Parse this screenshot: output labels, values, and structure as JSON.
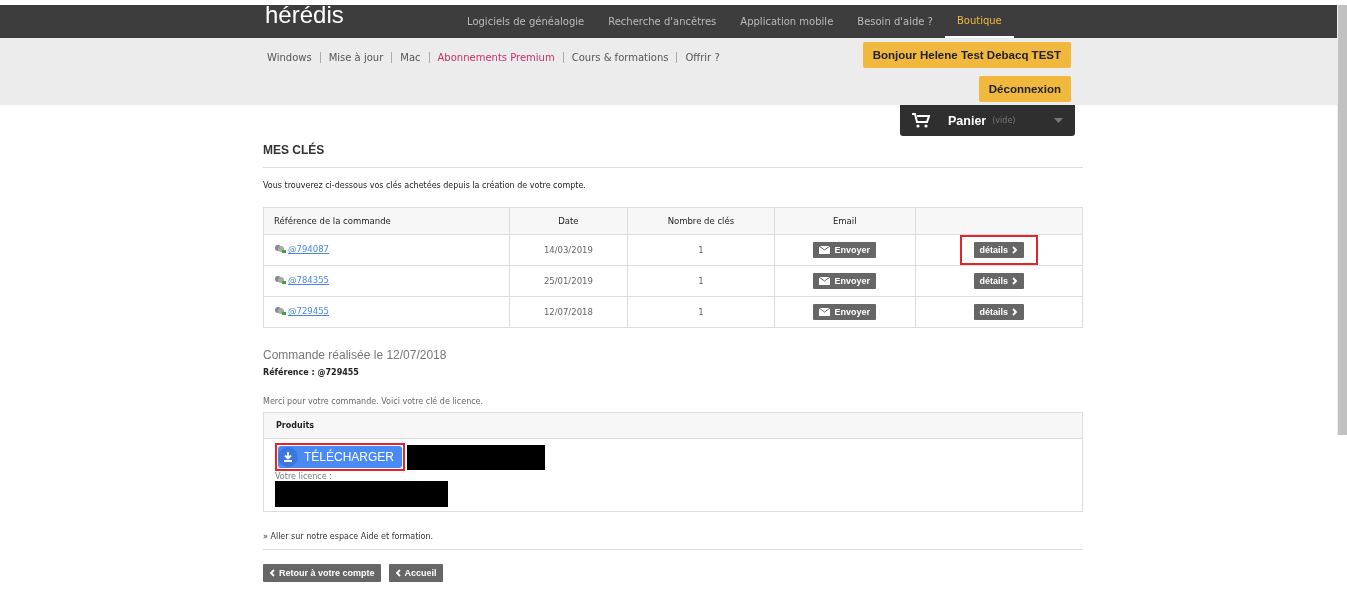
{
  "header": {
    "logo": "hérédis",
    "nav": [
      {
        "label": "Logiciels de généalogie",
        "selected": false
      },
      {
        "label": "Recherche d'ancêtres",
        "selected": false
      },
      {
        "label": "Application mobile",
        "selected": false
      },
      {
        "label": "Besoin d'aide ?",
        "selected": false
      },
      {
        "label": "Boutique",
        "selected": true
      }
    ]
  },
  "subnav": {
    "items": [
      {
        "label": "Windows",
        "selected": false
      },
      {
        "label": "Mise à jour",
        "selected": false
      },
      {
        "label": "Mac",
        "selected": false
      },
      {
        "label": "Abonnements Premium",
        "selected": true
      },
      {
        "label": "Cours & formations",
        "selected": false
      },
      {
        "label": "Offrir ?",
        "selected": false
      }
    ],
    "greeting": "Bonjour Helene Test Debacq TEST",
    "logout": "Déconnexion"
  },
  "cart": {
    "label": "Panier",
    "status": "(vide)"
  },
  "title": "MES CLÉS",
  "intro": "Vous trouverez ci-dessous vos clés achetées depuis la création de votre compte.",
  "table": {
    "columns": [
      "Référence de la commande",
      "Date",
      "Nombre de clés",
      "Email"
    ],
    "rows": [
      {
        "reference": "@794087",
        "date": "14/03/2019",
        "keys": "1",
        "email": "Envoyer",
        "details": "détails",
        "highlighted": true
      },
      {
        "reference": "@784355",
        "date": "25/01/2019",
        "keys": "1",
        "email": "Envoyer",
        "details": "détails",
        "highlighted": false
      },
      {
        "reference": "@729455",
        "date": "12/07/2018",
        "keys": "1",
        "email": "Envoyer",
        "details": "détails",
        "highlighted": false
      }
    ]
  },
  "order": {
    "heading": "Commande réalisée le 12/07/2018",
    "reference": "**Référence : @729455**",
    "thanks": "Merci pour votre commande. Voici votre clé de licence.",
    "products_label": "Produits",
    "download": {
      "label": "TÉLÉCHARGER",
      "highlighted": true
    },
    "license_label": "Votre licence :"
  },
  "help_link": "» Aller sur notre espace Aide et formation.",
  "footer_buttons": [
    "Retour à votre compte",
    "Accueil"
  ]
}
